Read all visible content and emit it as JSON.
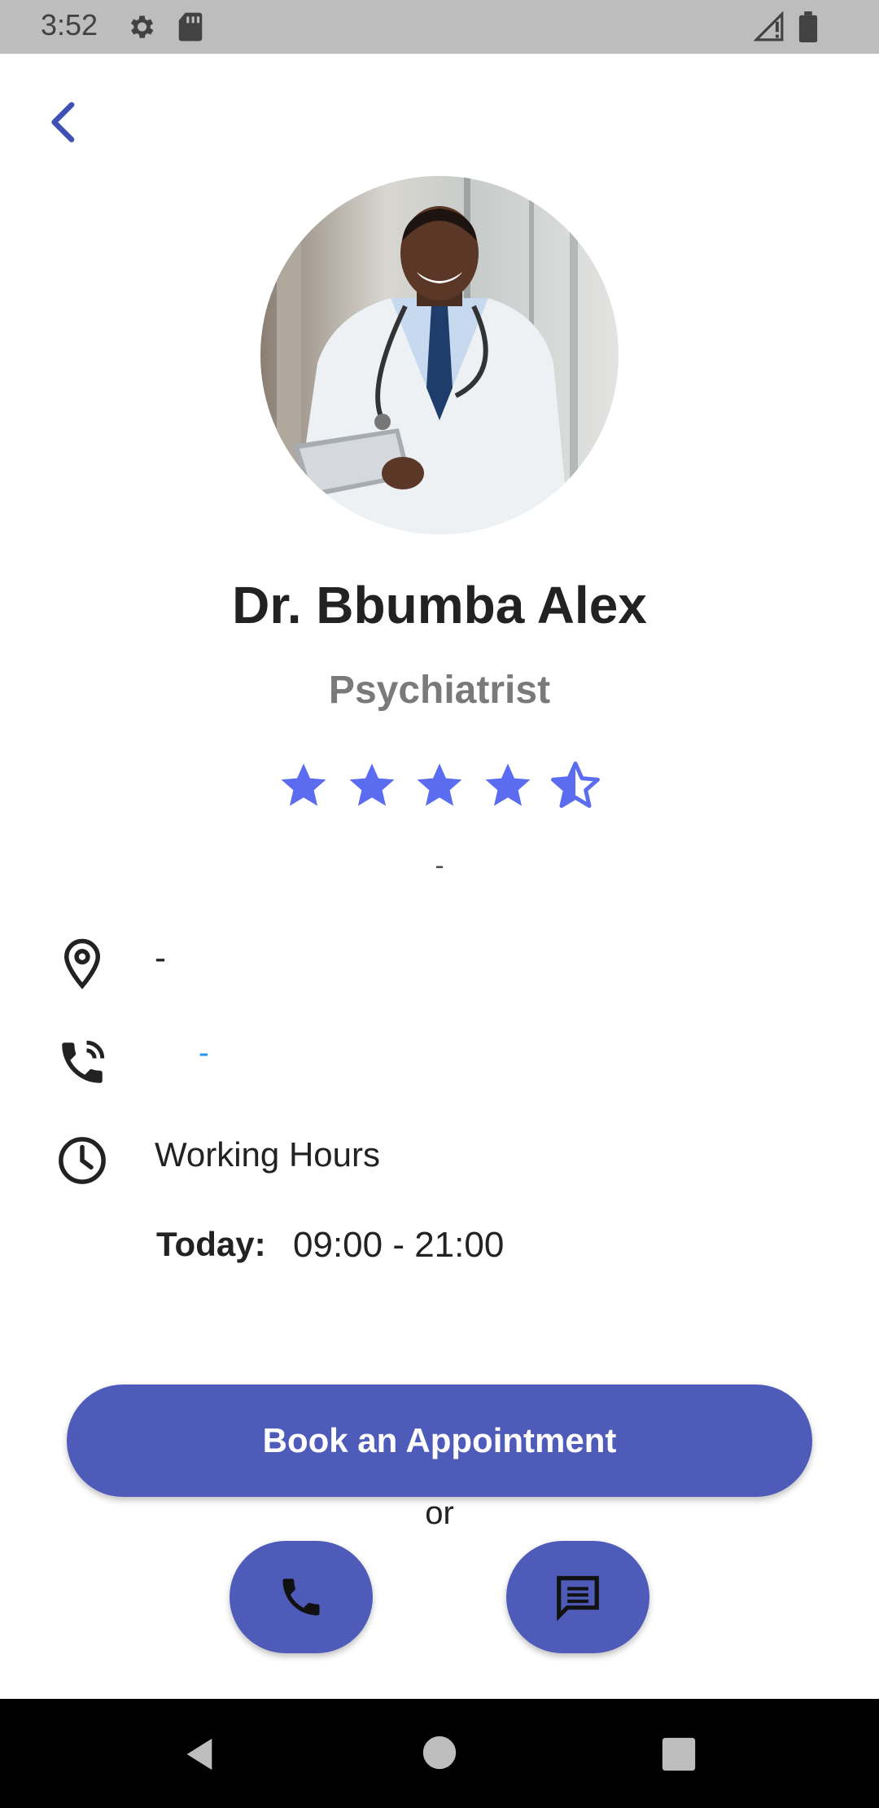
{
  "status_bar": {
    "time": "3:52",
    "icons": [
      "gear-icon",
      "sd-card-icon",
      "signal-icon",
      "battery-icon"
    ]
  },
  "header": {
    "back_icon": "chevron-left-icon"
  },
  "doctor": {
    "name": "Dr. Bbumba Alex",
    "specialty": "Psychiatrist",
    "rating": 4.5,
    "rating_max": 5,
    "bio": "-",
    "location": "-",
    "phone": "-",
    "working_hours_label": "Working Hours",
    "today_label": "Today:",
    "today_hours": "09:00 - 21:00"
  },
  "actions": {
    "book_label": "Book an Appointment",
    "or_label": "or",
    "call_icon": "phone-icon",
    "message_icon": "message-icon"
  },
  "colors": {
    "primary": "#4e5bb9",
    "star": "#5b6cf0",
    "link": "#2196f3"
  },
  "nav_bar": {
    "icons": [
      "back-triangle-icon",
      "home-circle-icon",
      "recents-square-icon"
    ]
  }
}
